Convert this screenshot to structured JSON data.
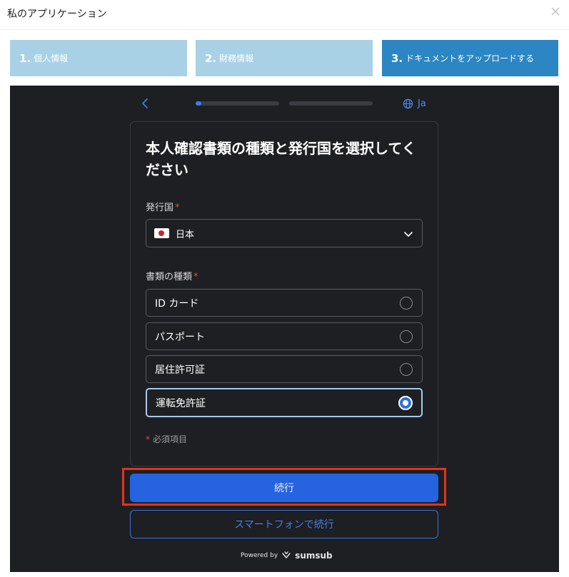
{
  "window": {
    "title": "私のアプリケーション"
  },
  "steps": [
    {
      "num": "1.",
      "label": "個人情報"
    },
    {
      "num": "2.",
      "label": "財務情報"
    },
    {
      "num": "3.",
      "label": "ドキュメントをアップロードする"
    }
  ],
  "progress": [
    0.07,
    0.0
  ],
  "language": "Ja",
  "form": {
    "title": "本人確認書類の種類と発行国を選択してください",
    "country_label": "発行国",
    "required_mark": "*",
    "country_value": "日本",
    "doctype_label": "書類の種類",
    "options": [
      {
        "label": "ID カード",
        "selected": false
      },
      {
        "label": "パスポート",
        "selected": false
      },
      {
        "label": "居住許可証",
        "selected": false
      },
      {
        "label": "運転免許証",
        "selected": true
      }
    ],
    "required_note": "必須項目"
  },
  "buttons": {
    "continue": "続行",
    "phone": "スマートフォンで続行"
  },
  "footer": {
    "powered_by": "Powered by",
    "brand": "sumsub"
  },
  "colors": {
    "accent": "#2563e0",
    "step_active": "#2b86c3",
    "step_inactive": "#a9d1e6",
    "highlight": "#e1341e",
    "required": "#e0474a",
    "panel_bg": "#1e1f22"
  }
}
